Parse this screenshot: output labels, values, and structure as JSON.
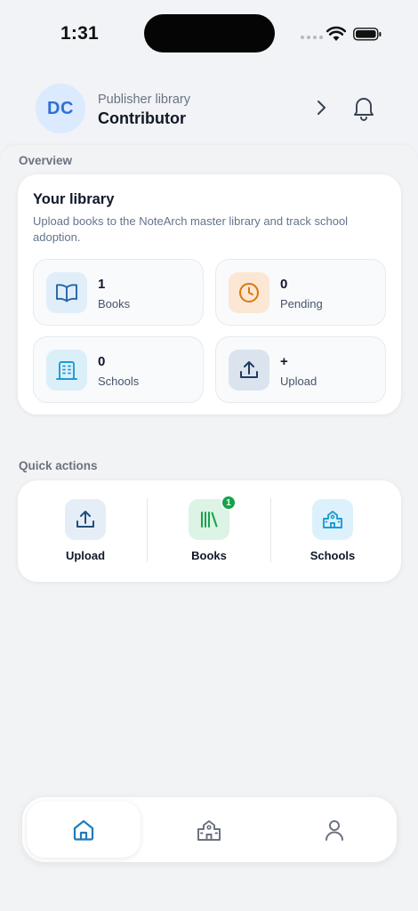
{
  "status_bar": {
    "time": "1:31"
  },
  "header": {
    "avatar_initials": "DC",
    "subtitle": "Publisher library",
    "title": "Contributor"
  },
  "overview": {
    "section_label": "Overview",
    "card_title": "Your library",
    "card_description": "Upload books to the NoteArch master library and track school adoption.",
    "stats": [
      {
        "value": "1",
        "label": "Books",
        "icon": "book-open-icon",
        "bg": "#e0eef9",
        "color": "#2563a8"
      },
      {
        "value": "0",
        "label": "Pending",
        "icon": "clock-icon",
        "bg": "#fbe7d3",
        "color": "#d9780f"
      },
      {
        "value": "0",
        "label": "Schools",
        "icon": "building-icon",
        "bg": "#dbeff9",
        "color": "#1d9bd6"
      },
      {
        "value": "+",
        "label": "Upload",
        "icon": "upload-icon",
        "bg": "#dbe4ee",
        "color": "#1e3a5f"
      }
    ]
  },
  "quick_actions": {
    "section_label": "Quick actions",
    "items": [
      {
        "label": "Upload",
        "icon": "upload-icon",
        "bg": "#e5eef6"
      },
      {
        "label": "Books",
        "icon": "library-icon",
        "bg": "#dcf3e6",
        "badge": "1"
      },
      {
        "label": "Schools",
        "icon": "school-icon",
        "bg": "#dcf1fb"
      }
    ]
  },
  "bottom_nav": {
    "items": [
      {
        "icon": "home-icon",
        "active": true
      },
      {
        "icon": "school-icon",
        "active": false
      },
      {
        "icon": "person-icon",
        "active": false
      }
    ]
  },
  "colors": {
    "accent": "#2f6fd8",
    "nav_active": "#1e7bbd",
    "badge": "#16a34a"
  }
}
